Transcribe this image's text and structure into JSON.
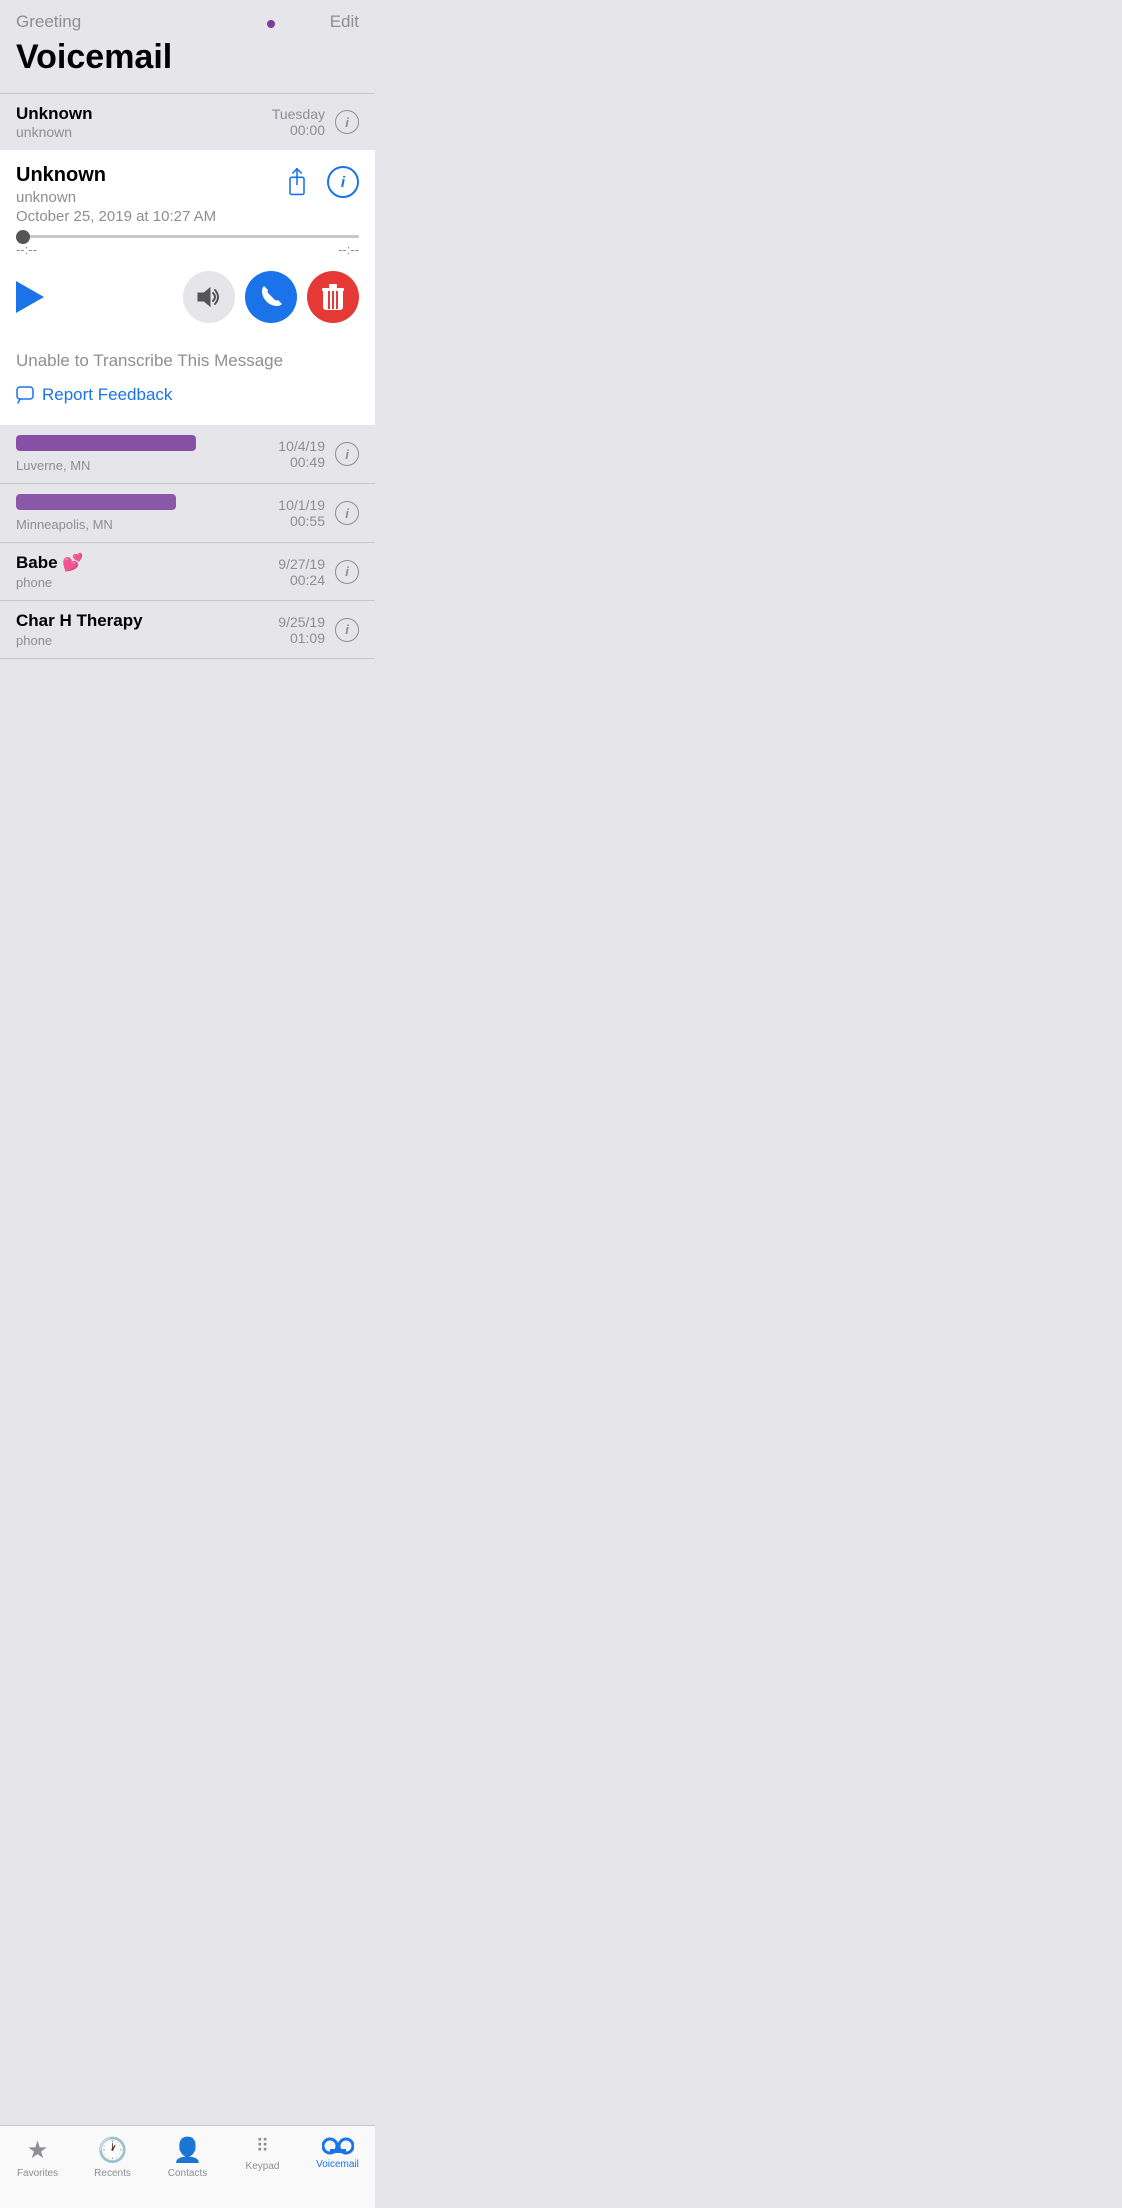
{
  "header": {
    "greeting_label": "Greeting",
    "edit_label": "Edit",
    "page_title": "Voicemail"
  },
  "first_voicemail_preview": {
    "name": "Unknown",
    "sub": "unknown",
    "date": "Tuesday",
    "time": "00:00"
  },
  "voicemail_card": {
    "name": "Unknown",
    "sub": "unknown",
    "date": "October 25, 2019 at 10:27 AM",
    "progress_start": "--:--",
    "progress_end": "--:--",
    "transcription_text": "Unable to Transcribe This Message",
    "report_feedback_label": "Report Feedback"
  },
  "voicemail_list": [
    {
      "name": "[redacted1]",
      "location": "Luverne, MN",
      "date": "10/4/19",
      "duration": "00:49"
    },
    {
      "name": "[redacted2]",
      "location": "Minneapolis, MN",
      "date": "10/1/19",
      "duration": "00:55"
    },
    {
      "name": "Babe 💕",
      "location": "phone",
      "date": "9/27/19",
      "duration": "00:24"
    },
    {
      "name": "Char H Therapy",
      "location": "phone",
      "date": "9/25/19",
      "duration": "01:09"
    }
  ],
  "tab_bar": {
    "tabs": [
      {
        "id": "favorites",
        "label": "Favorites",
        "icon": "★",
        "active": false
      },
      {
        "id": "recents",
        "label": "Recents",
        "icon": "🕐",
        "active": false
      },
      {
        "id": "contacts",
        "label": "Contacts",
        "icon": "👤",
        "active": false
      },
      {
        "id": "keypad",
        "label": "Keypad",
        "icon": "⠿",
        "active": false
      },
      {
        "id": "voicemail",
        "label": "Voicemail",
        "icon": "vm",
        "active": true
      }
    ]
  }
}
